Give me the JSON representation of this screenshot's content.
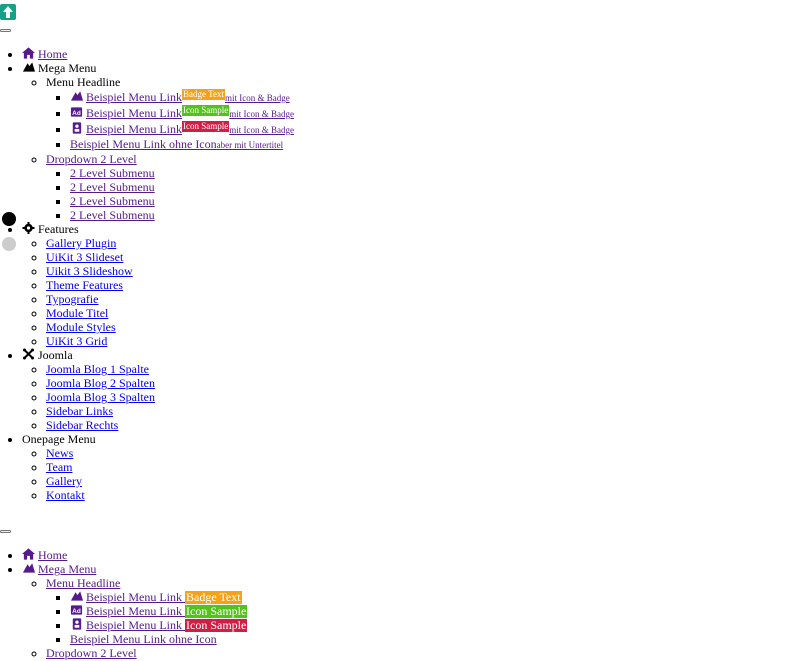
{
  "colors": {
    "link": "#551a8b",
    "link_blue": "#0000ee",
    "logo": "#16a085",
    "badge_orange": "#f5a21b",
    "badge_green": "#53c21d",
    "badge_red": "#d21d44"
  },
  "nav1": {
    "home": "Home",
    "mega": "Mega Menu",
    "headline": "Menu Headline",
    "items": [
      {
        "label": "Beispiel Menu Link",
        "badge": "Badge Text",
        "sub": "mit Icon & Badge"
      },
      {
        "label": "Beispiel Menu Link",
        "badge": "Icon Sample",
        "sub": "mit Icon & Badge"
      },
      {
        "label": "Beispiel Menu Link",
        "badge": "Icon Sample",
        "sub": "mit Icon & Badge"
      },
      {
        "label": "Beispiel Menu Link ohne Icon",
        "sub": "aber mit Untertitel"
      }
    ],
    "dropdown": "Dropdown 2 Level",
    "submenu": [
      "2 Level Submenu",
      "2 Level Submenu",
      "2 Level Submenu",
      "2 Level Submenu"
    ],
    "features": "Features",
    "features_items": [
      "Gallery Plugin",
      "UiKit 3 Slideset",
      "Uikit 3 Slideshow",
      "Theme Features",
      "Typografie",
      "Module Titel",
      "Module Styles",
      "UiKit 3 Grid"
    ],
    "joomla": "Joomla",
    "joomla_items": [
      "Joomla Blog 1 Spalte",
      "Joomla Blog 2 Spalten",
      "Joomla Blog 3 Spalten",
      "Sidebar Links",
      "Sidebar Rechts"
    ],
    "onepage": "Onepage Menu",
    "onepage_items": [
      "News",
      "Team",
      "Gallery",
      "Kontakt"
    ]
  },
  "nav2": {
    "home": "Home",
    "mega": "Mega Menu",
    "headline": "Menu Headline",
    "items": [
      {
        "label": "Beispiel Menu Link",
        "badge": "Badge Text"
      },
      {
        "label": "Beispiel Menu Link",
        "badge": "Icon Sample"
      },
      {
        "label": "Beispiel Menu Link",
        "badge": "Icon Sample"
      },
      {
        "label": "Beispiel Menu Link ohne Icon"
      }
    ],
    "dropdown": "Dropdown 2 Level"
  },
  "icons": {
    "home": "home-icon",
    "mega": "mega-icon",
    "ad": "ad-icon",
    "contact": "contact-icon",
    "gear": "gear-icon",
    "joomla": "joomla-icon"
  }
}
